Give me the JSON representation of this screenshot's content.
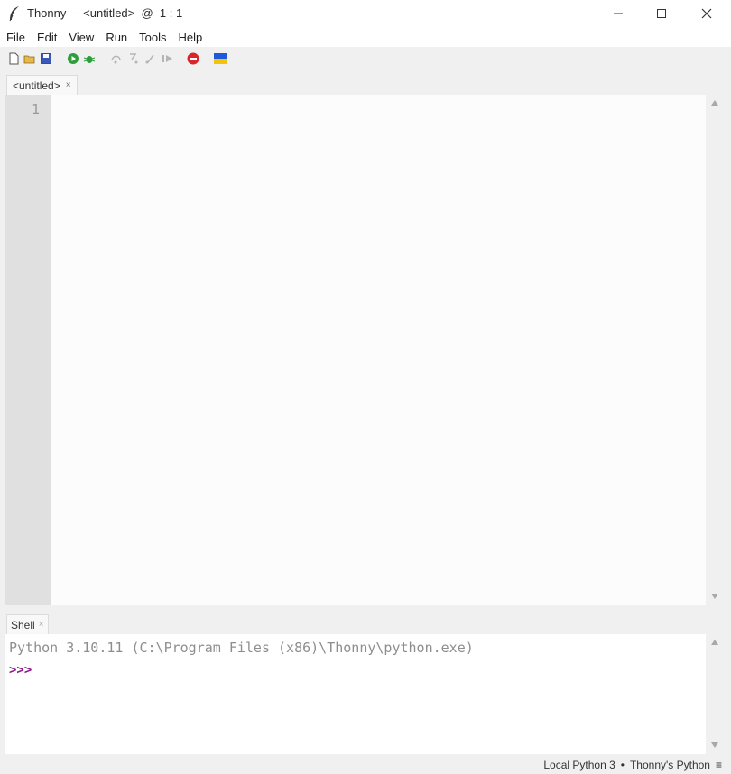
{
  "window": {
    "title": "Thonny  -  <untitled>  @  1 : 1",
    "app_icon": "feather-icon",
    "controls": [
      "minimize-icon",
      "maximize-icon",
      "close-icon"
    ]
  },
  "menu": [
    "File",
    "Edit",
    "View",
    "Run",
    "Tools",
    "Help"
  ],
  "toolbar": {
    "buttons": [
      "new-file-icon",
      "open-folder-icon",
      "save-icon",
      "run-icon",
      "debug-icon",
      "step-over-icon",
      "step-into-icon",
      "step-out-icon",
      "resume-icon",
      "stop-icon",
      "ukraine-flag-icon"
    ],
    "colors": {
      "run": "#2e9e3a",
      "stop": "#d9262b",
      "flag_blue": "#1f5bd6",
      "flag_yellow": "#f4c30b"
    }
  },
  "editor": {
    "tab_label": "<untitled>",
    "tab_close": "×",
    "line_numbers": [
      "1"
    ]
  },
  "shell": {
    "tab_label": "Shell",
    "tab_close": "×",
    "banner": "Python 3.10.11 (C:\\Program Files (x86)\\Thonny\\python.exe)",
    "prompt": ">>>"
  },
  "status": {
    "interpreter": "Local Python 3",
    "separator": "•",
    "python_name": "Thonny's Python",
    "menu_glyph": "≡"
  }
}
